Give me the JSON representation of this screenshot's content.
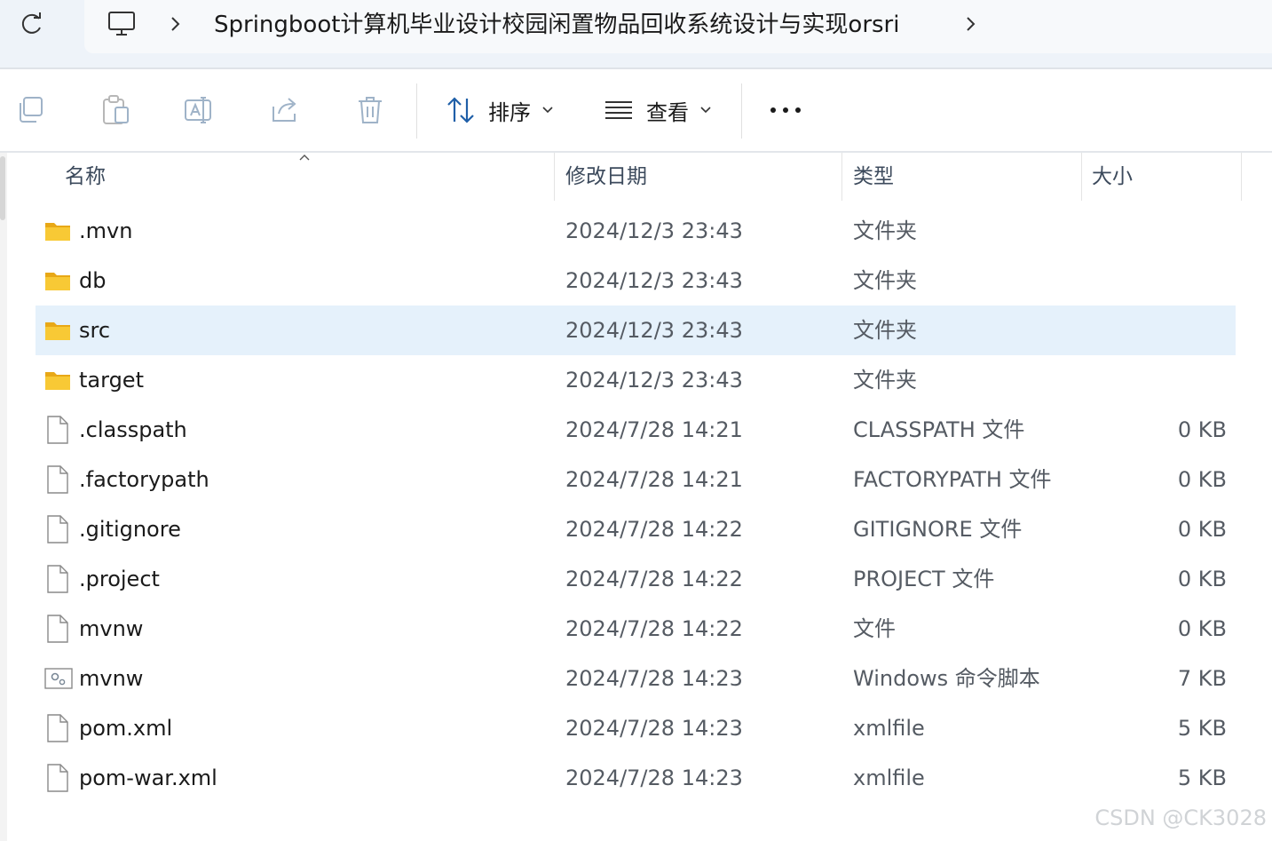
{
  "address_bar": {
    "path_title": "Springboot计算机毕业设计校园闲置物品回收系统设计与实现orsri"
  },
  "toolbar": {
    "sort_label": "排序",
    "view_label": "查看"
  },
  "columns": {
    "name": "名称",
    "modified": "修改日期",
    "type": "类型",
    "size": "大小"
  },
  "files": [
    {
      "name": ".mvn",
      "modified": "2024/12/3 23:43",
      "type": "文件夹",
      "size": "",
      "icon": "folder-icon"
    },
    {
      "name": "db",
      "modified": "2024/12/3 23:43",
      "type": "文件夹",
      "size": "",
      "icon": "folder-icon"
    },
    {
      "name": "src",
      "modified": "2024/12/3 23:43",
      "type": "文件夹",
      "size": "",
      "icon": "folder-icon",
      "selected": true
    },
    {
      "name": "target",
      "modified": "2024/12/3 23:43",
      "type": "文件夹",
      "size": "",
      "icon": "folder-icon"
    },
    {
      "name": ".classpath",
      "modified": "2024/7/28 14:21",
      "type": "CLASSPATH 文件",
      "size": "0 KB",
      "icon": "file-icon"
    },
    {
      "name": ".factorypath",
      "modified": "2024/7/28 14:21",
      "type": "FACTORYPATH 文件",
      "size": "0 KB",
      "icon": "file-icon"
    },
    {
      "name": ".gitignore",
      "modified": "2024/7/28 14:22",
      "type": "GITIGNORE 文件",
      "size": "0 KB",
      "icon": "file-icon"
    },
    {
      "name": ".project",
      "modified": "2024/7/28 14:22",
      "type": "PROJECT 文件",
      "size": "0 KB",
      "icon": "file-icon"
    },
    {
      "name": "mvnw",
      "modified": "2024/7/28 14:22",
      "type": "文件",
      "size": "0 KB",
      "icon": "file-icon"
    },
    {
      "name": "mvnw",
      "modified": "2024/7/28 14:23",
      "type": "Windows 命令脚本",
      "size": "7 KB",
      "icon": "script-icon"
    },
    {
      "name": "pom.xml",
      "modified": "2024/7/28 14:23",
      "type": "xmlfile",
      "size": "5 KB",
      "icon": "file-icon"
    },
    {
      "name": "pom-war.xml",
      "modified": "2024/7/28 14:23",
      "type": "xmlfile",
      "size": "5 KB",
      "icon": "file-icon"
    }
  ],
  "watermark": "CSDN @CK3028",
  "colors": {
    "selected_row": "#e5f1fb",
    "folder": "#f8c935",
    "address_bg": "#eef3f9"
  }
}
